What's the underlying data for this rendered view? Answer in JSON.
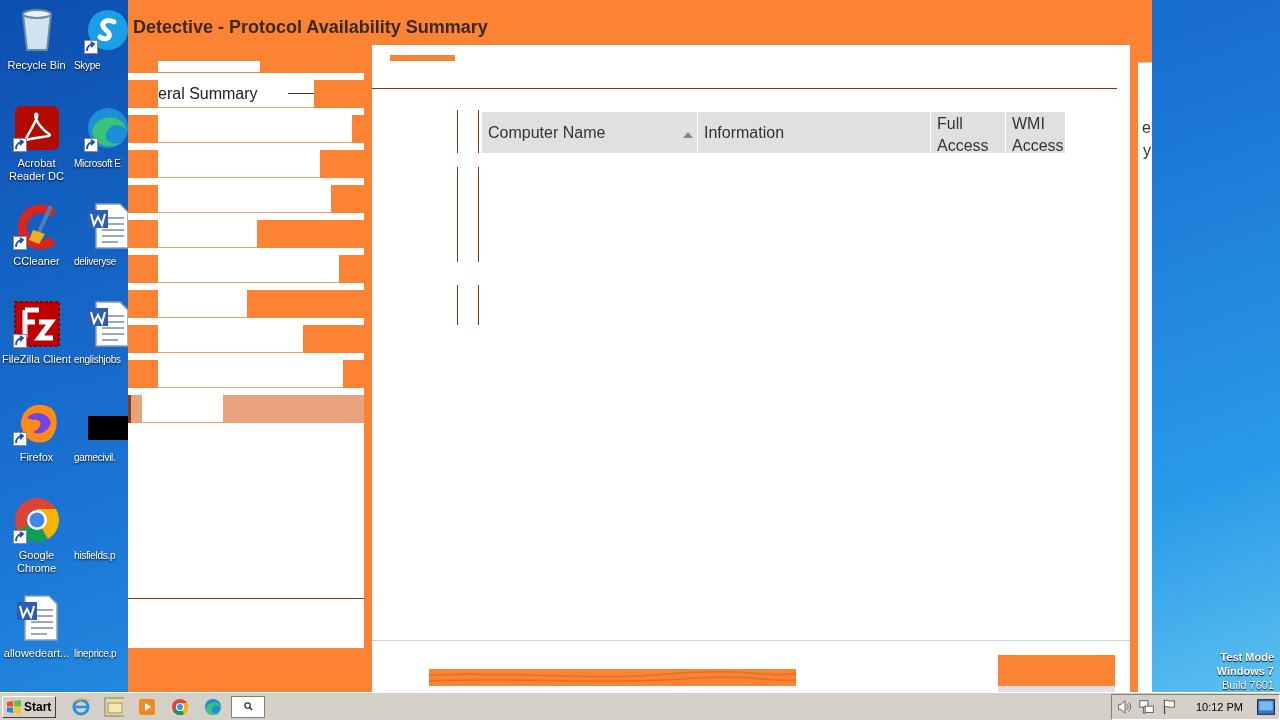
{
  "window": {
    "title": "Detective - Protocol Availability Summary"
  },
  "sidebar": {
    "items": [
      {
        "label": "eral Summary",
        "selected": false
      },
      {
        "selected": false
      },
      {
        "selected": false
      },
      {
        "selected": false
      },
      {
        "selected": false
      },
      {
        "selected": false
      },
      {
        "selected": false
      },
      {
        "selected": false
      },
      {
        "selected": false
      },
      {
        "selected": true
      }
    ]
  },
  "table": {
    "columns": [
      {
        "label": "Computer Name",
        "sorted": true
      },
      {
        "label": "Information",
        "sorted": false
      },
      {
        "label": "Full Access",
        "sorted": false
      },
      {
        "label": "WMI Access",
        "sorted": false
      }
    ]
  },
  "right_panel": {
    "fragments": [
      "e",
      "y"
    ]
  },
  "desktop": {
    "icons": [
      {
        "label": "Recycle Bin",
        "kind": "trash",
        "shortcut": false
      },
      {
        "label": "Skype",
        "kind": "chat",
        "shortcut": true
      },
      {
        "label": "Acrobat Reader DC",
        "kind": "pdf",
        "shortcut": true
      },
      {
        "label": "Microsoft E",
        "kind": "edge",
        "shortcut": true
      },
      {
        "label": "CCleaner",
        "kind": "cleaner",
        "shortcut": true
      },
      {
        "label": "deliveryse",
        "kind": "word",
        "shortcut": false
      },
      {
        "label": "FileZilla Client",
        "kind": "ftp",
        "shortcut": true
      },
      {
        "label": "englishjobs",
        "kind": "word",
        "shortcut": false
      },
      {
        "label": "Firefox",
        "kind": "fox",
        "shortcut": true
      },
      {
        "label": "gamecivil.",
        "kind": "black",
        "shortcut": false
      },
      {
        "label": "Google Chrome",
        "kind": "chrome",
        "shortcut": true
      },
      {
        "label": "hisfields.p",
        "kind": "blank",
        "shortcut": false
      },
      {
        "label": "allowedeart...",
        "kind": "word",
        "shortcut": false
      },
      {
        "label": "lineprice.p",
        "kind": "blank",
        "shortcut": false
      }
    ],
    "system_notice": [
      "Test Mode",
      "Windows 7",
      "Build 7601"
    ]
  },
  "taskbar": {
    "start": "Start",
    "pinned": [
      {
        "kind": "ie"
      },
      {
        "kind": "folder"
      },
      {
        "kind": "media"
      },
      {
        "kind": "chrome"
      },
      {
        "kind": "edge"
      },
      {
        "kind": "search"
      }
    ],
    "tray": [
      {
        "kind": "speaker"
      },
      {
        "kind": "network"
      },
      {
        "kind": "flag"
      }
    ],
    "clock": "10:12 PM"
  }
}
